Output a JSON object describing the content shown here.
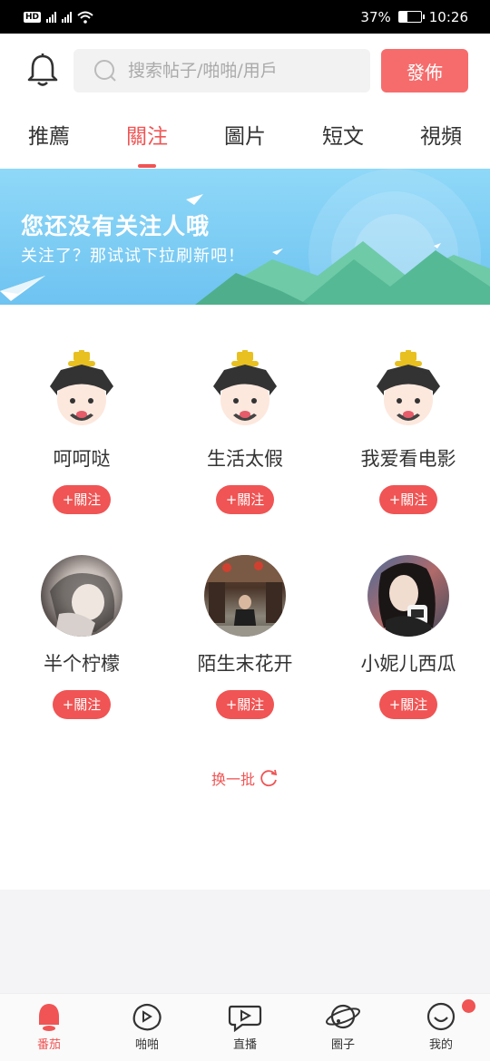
{
  "status_bar": {
    "hd": "HD",
    "net1": "4G",
    "net2": "4G+",
    "battery_percent": "37%",
    "battery_level": 0.37,
    "time": "10:26"
  },
  "header": {
    "search_placeholder": "搜索帖子/啪啪/用戶",
    "publish_label": "發佈"
  },
  "tabs": [
    {
      "label": "推薦",
      "active": false
    },
    {
      "label": "關注",
      "active": true
    },
    {
      "label": "圖片",
      "active": false
    },
    {
      "label": "短文",
      "active": false
    },
    {
      "label": "視頻",
      "active": false
    }
  ],
  "banner": {
    "title": "您还没有关注人哦",
    "subtitle": "关注了？那试试下拉刷新吧！"
  },
  "suggested_users": [
    {
      "name": "呵呵哒",
      "avatar": "default-cartoon-avatar",
      "follow_label": "+關注"
    },
    {
      "name": "生活太假",
      "avatar": "default-cartoon-avatar",
      "follow_label": "+關注"
    },
    {
      "name": "我爱看电影",
      "avatar": "default-cartoon-avatar",
      "follow_label": "+關注"
    },
    {
      "name": "半个柠檬",
      "avatar": "photo-avatar",
      "follow_label": "+關注"
    },
    {
      "name": "陌生末花开",
      "avatar": "photo-avatar",
      "follow_label": "+關注"
    },
    {
      "name": "小妮儿西瓜",
      "avatar": "photo-avatar",
      "follow_label": "+關注"
    }
  ],
  "refresh_label": "换一批",
  "bottom_nav": [
    {
      "label": "番茄",
      "icon": "tomato-icon",
      "active": true
    },
    {
      "label": "啪啪",
      "icon": "papa-icon",
      "active": false
    },
    {
      "label": "直播",
      "icon": "live-icon",
      "active": false
    },
    {
      "label": "圈子",
      "icon": "planet-icon",
      "active": false
    },
    {
      "label": "我的",
      "icon": "profile-icon",
      "active": false
    }
  ],
  "colors": {
    "accent": "#f05454",
    "publish_button": "#f66c6c",
    "banner_sky": "#8fd8f8"
  }
}
